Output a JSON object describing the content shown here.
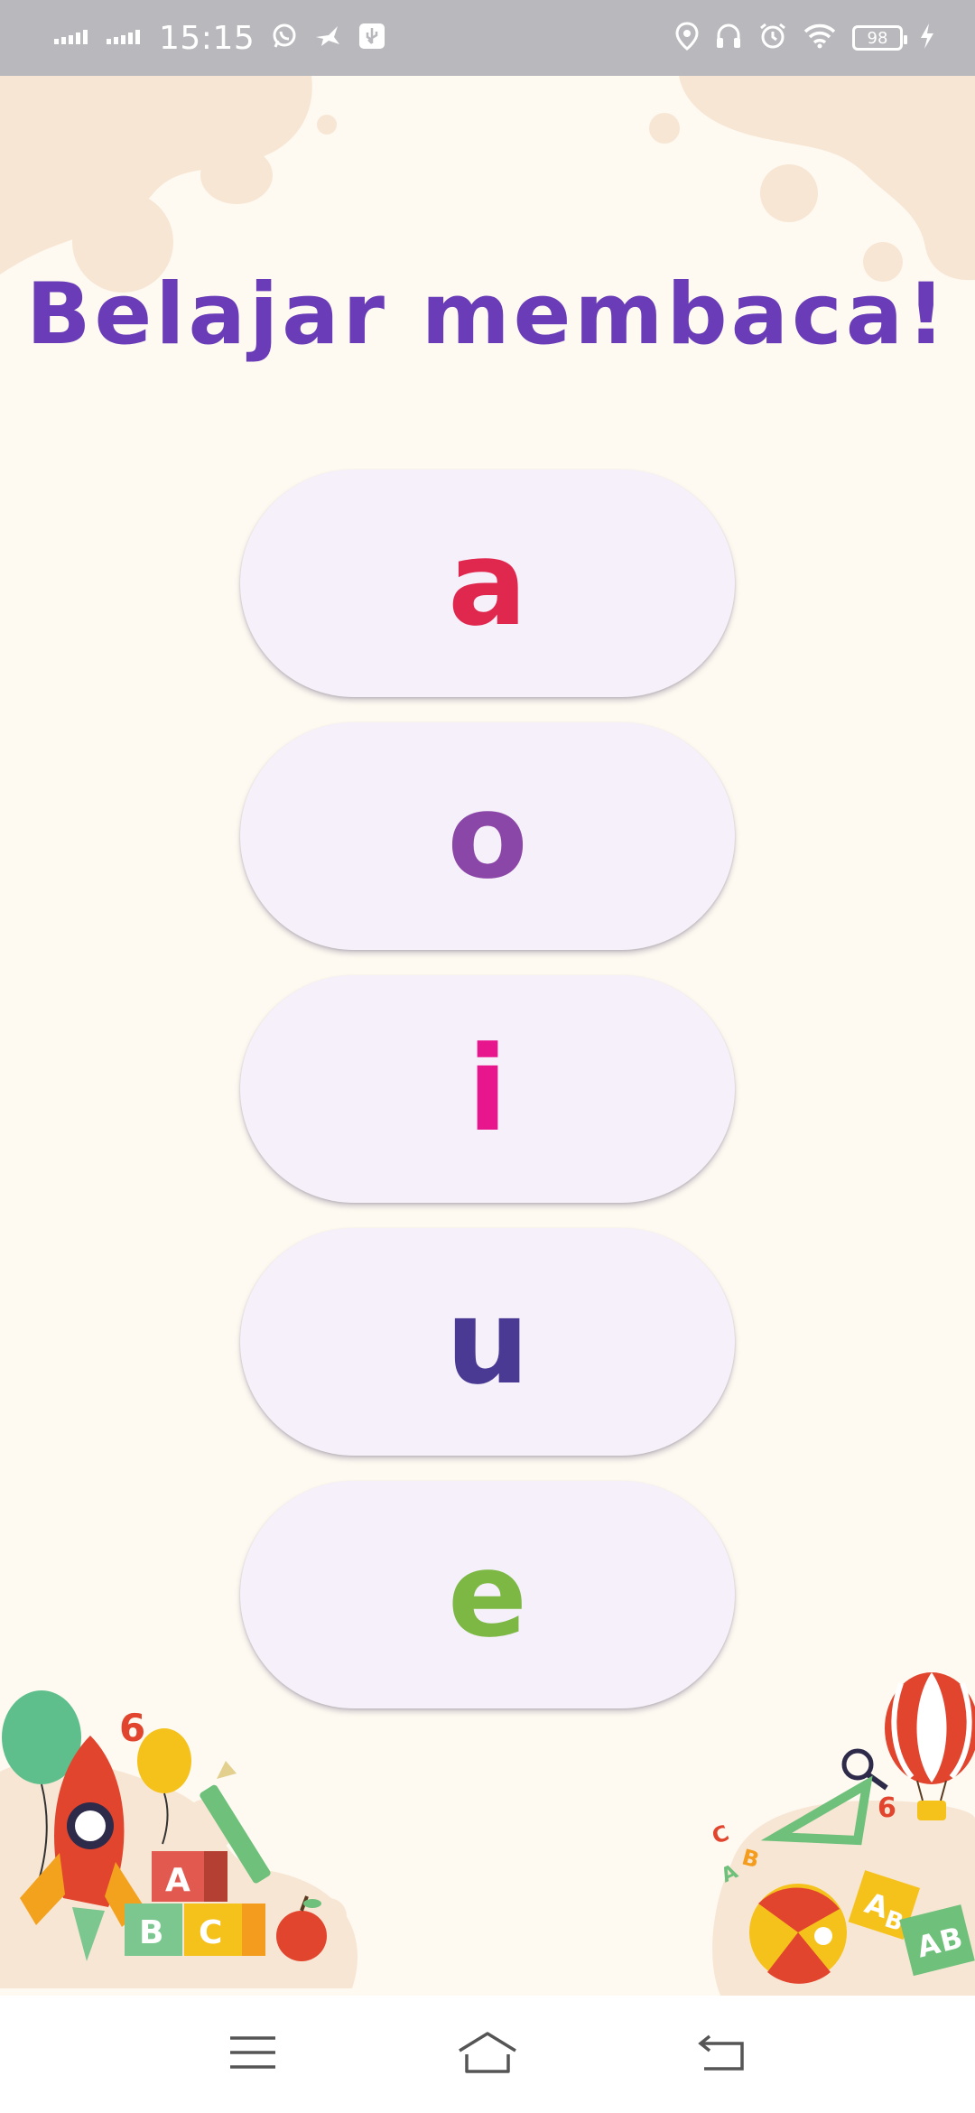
{
  "status_bar": {
    "time": "15:15",
    "battery": "98",
    "left_icons": [
      "signal-icon",
      "signal-icon",
      "whatsapp-icon",
      "bird-icon",
      "usb-icon"
    ],
    "right_icons": [
      "location-icon",
      "headphones-icon",
      "alarm-icon",
      "wifi-icon",
      "battery-icon",
      "charging-icon"
    ]
  },
  "app": {
    "title": "Belajar membaca!",
    "letters": [
      {
        "label": "a",
        "color": "#e0284f"
      },
      {
        "label": "o",
        "color": "#8a47a7"
      },
      {
        "label": "i",
        "color": "#e8168d"
      },
      {
        "label": "u",
        "color": "#4b3a93"
      },
      {
        "label": "e",
        "color": "#7cb843"
      }
    ],
    "illustration_text": {
      "blocks_left": [
        "A",
        "B",
        "C"
      ],
      "blocks_right": [
        "A",
        "B",
        "A",
        "B"
      ],
      "number_left": "6",
      "number_right": "6"
    }
  },
  "nav_bar": {
    "buttons": [
      "menu-icon",
      "home-icon",
      "back-icon"
    ]
  },
  "colors": {
    "title": "#6a3cb7",
    "background": "#fefaf1",
    "button_bg": "#f5f0fa",
    "status_bar_bg": "#b9b8bd",
    "decoration_peach": "#f8e6d4"
  }
}
